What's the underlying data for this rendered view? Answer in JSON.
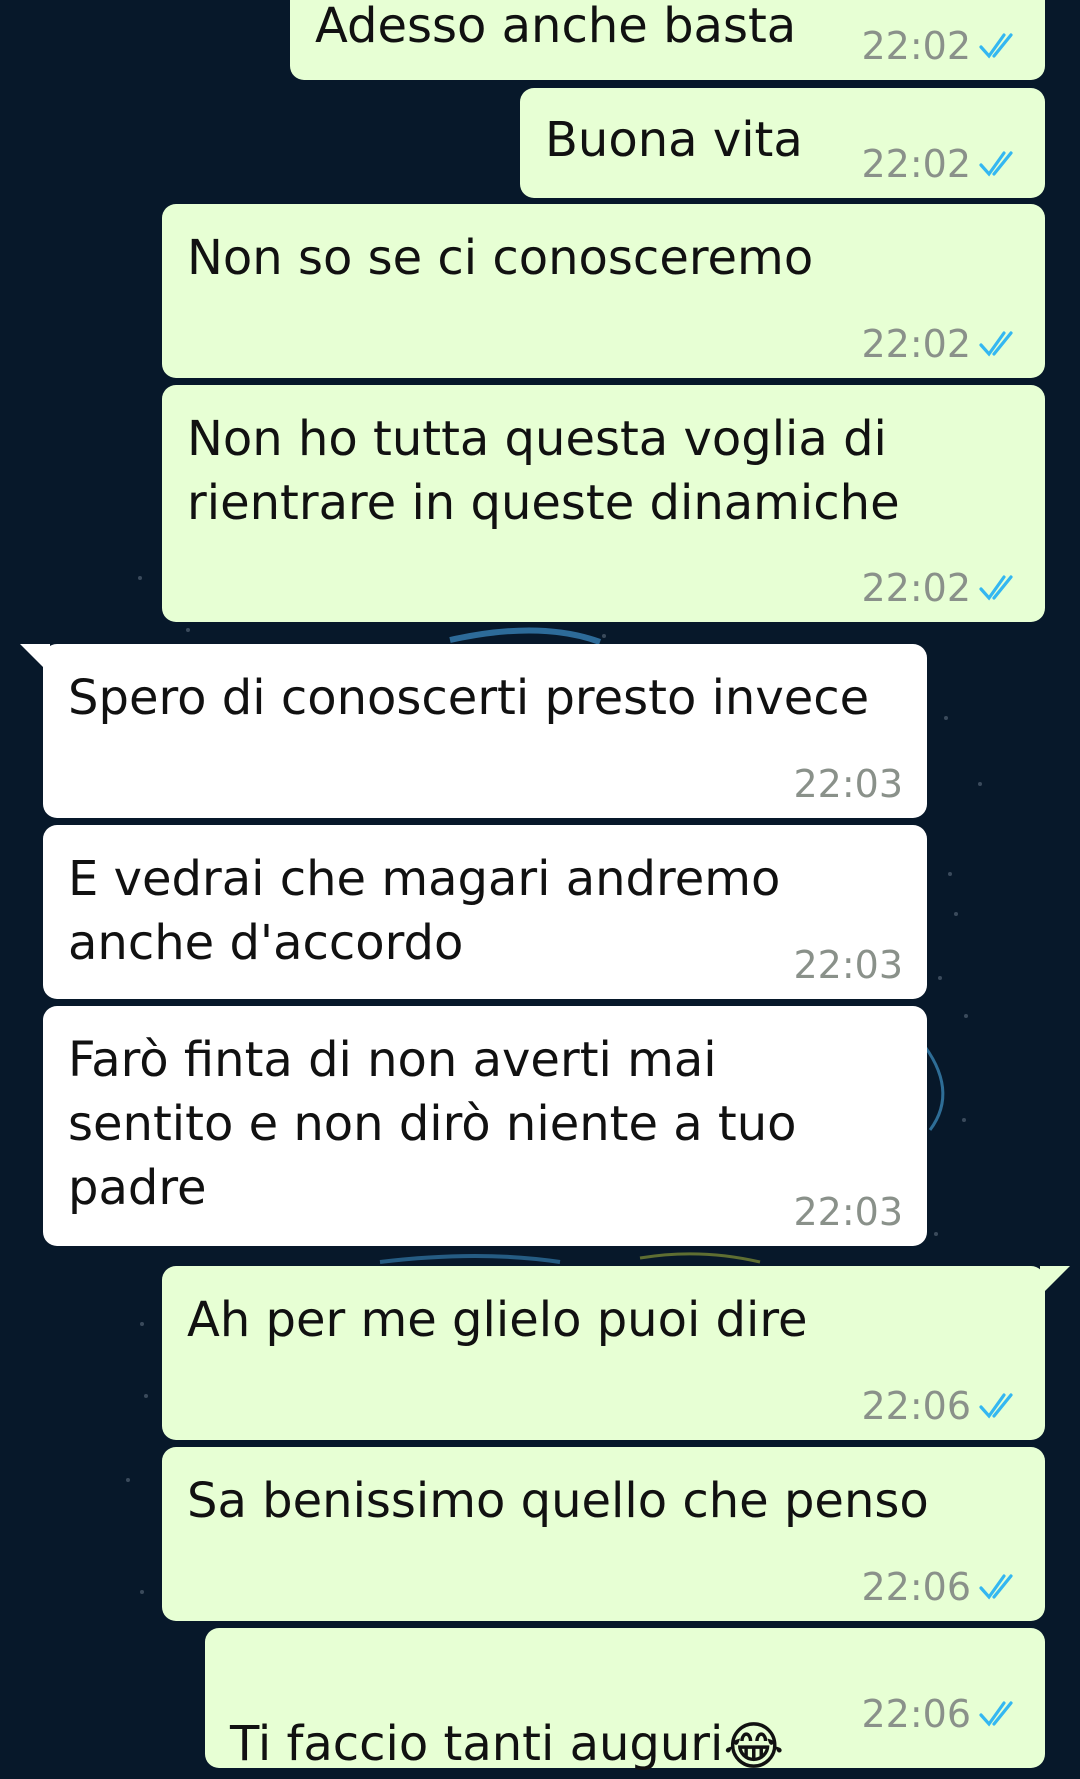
{
  "messages": [
    {
      "direction": "out",
      "text": "Adesso anche basta",
      "time": "22:02",
      "status": "read"
    },
    {
      "direction": "out",
      "text": "Buona vita",
      "time": "22:02",
      "status": "read"
    },
    {
      "direction": "out",
      "text": "Non so se ci conosceremo",
      "time": "22:02",
      "status": "read"
    },
    {
      "direction": "out",
      "text": "Non ho tutta questa voglia di\nrientrare in queste dinamiche",
      "time": "22:02",
      "status": "read"
    },
    {
      "direction": "in",
      "text": "Spero di conoscerti presto invece",
      "time": "22:03"
    },
    {
      "direction": "in",
      "text": "E vedrai che magari andremo\nanche d'accordo",
      "time": "22:03"
    },
    {
      "direction": "in",
      "text": "Farò finta di non averti mai\nsentito e non dirò niente a tuo\npadre",
      "time": "22:03"
    },
    {
      "direction": "out",
      "text": "Ah per me glielo puoi dire",
      "time": "22:06",
      "status": "read"
    },
    {
      "direction": "out",
      "text": "Sa benissimo quello che penso",
      "time": "22:06",
      "status": "read"
    },
    {
      "direction": "out",
      "text": "Ti faccio tanti auguri",
      "emoji": "😂",
      "time": "22:06",
      "status": "read"
    }
  ],
  "colors": {
    "background": "#07182a",
    "outgoing_bubble": "#e7ffd4",
    "incoming_bubble": "#ffffff",
    "read_ticks": "#34b7f1",
    "time_text": "#8a918a"
  },
  "icons": {
    "read_receipt": "double-check-icon"
  }
}
